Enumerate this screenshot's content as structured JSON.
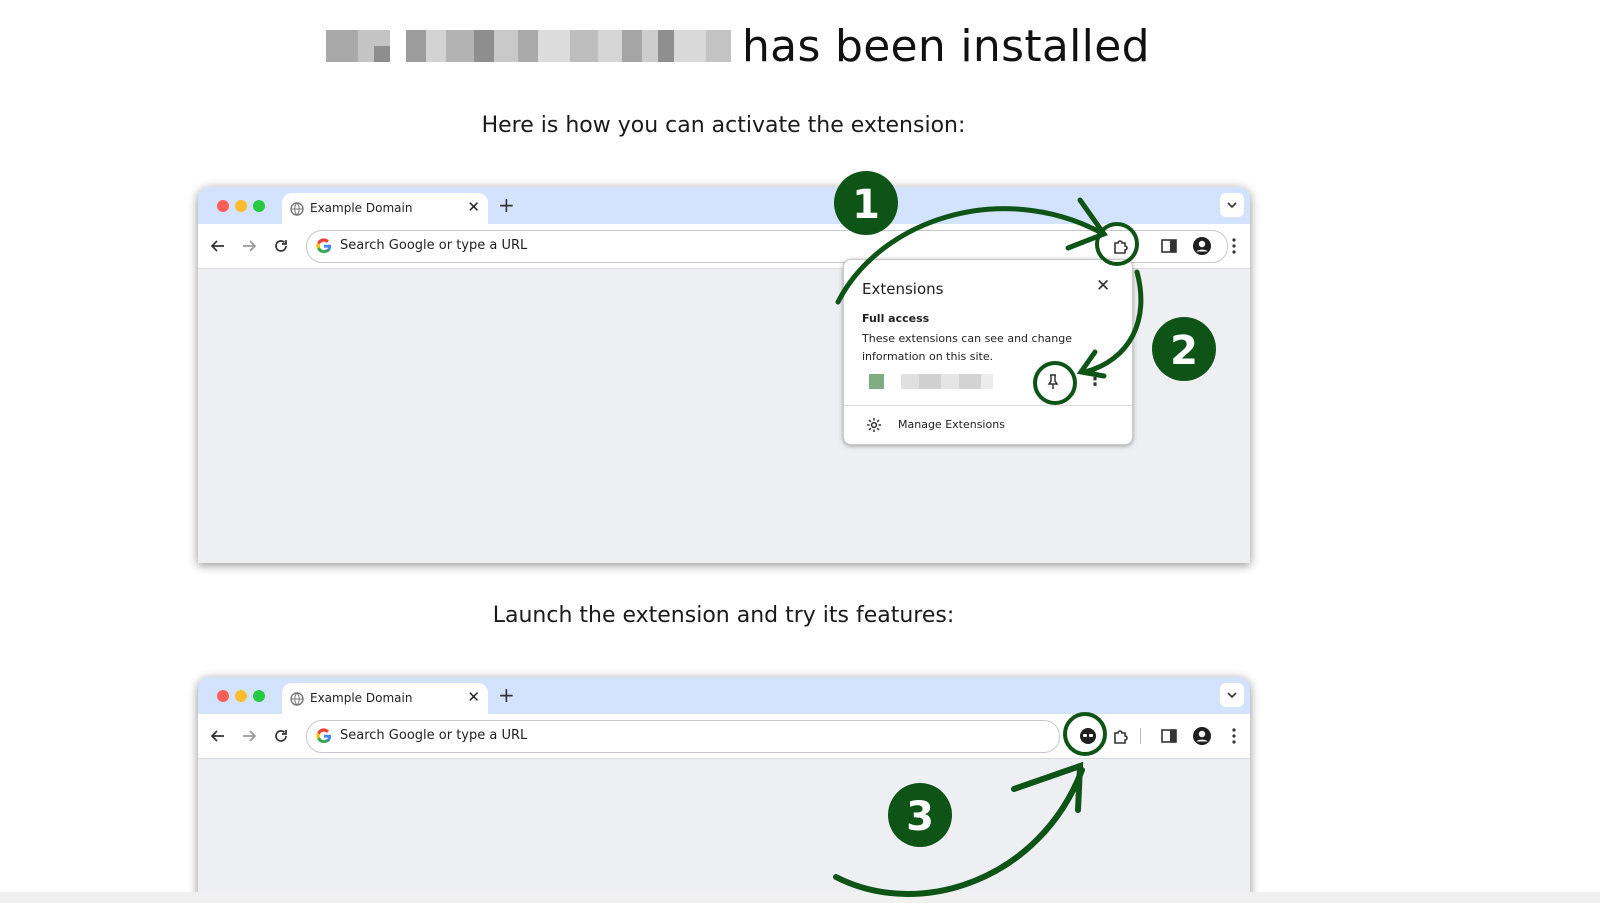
{
  "header": {
    "title_suffix": "has been installed",
    "extension_name_redacted": true
  },
  "section1": {
    "subtitle": "Here is how you can activate the extension:"
  },
  "section2": {
    "subtitle": "Launch the extension and try its features:"
  },
  "browser": {
    "tab_title": "Example Domain",
    "tab_close": "✕",
    "new_tab": "+",
    "omnibox_placeholder": "Search Google or type a URL"
  },
  "extensions_popup": {
    "title": "Extensions",
    "close": "✕",
    "section_title": "Full access",
    "description": "These extensions can see and change information on this site.",
    "more": "⋮",
    "manage_label": "Manage Extensions"
  },
  "steps": [
    {
      "number": "1"
    },
    {
      "number": "2"
    },
    {
      "number": "3"
    }
  ],
  "colors": {
    "accent_green": "#0f5417",
    "tabstrip_blue": "#d3e3fd",
    "content_gray": "#eeeff2",
    "close_red": "#ff5f57",
    "minimize_yellow": "#febc2e",
    "zoom_green": "#28c840",
    "extension_swatch": "#7fae83"
  }
}
